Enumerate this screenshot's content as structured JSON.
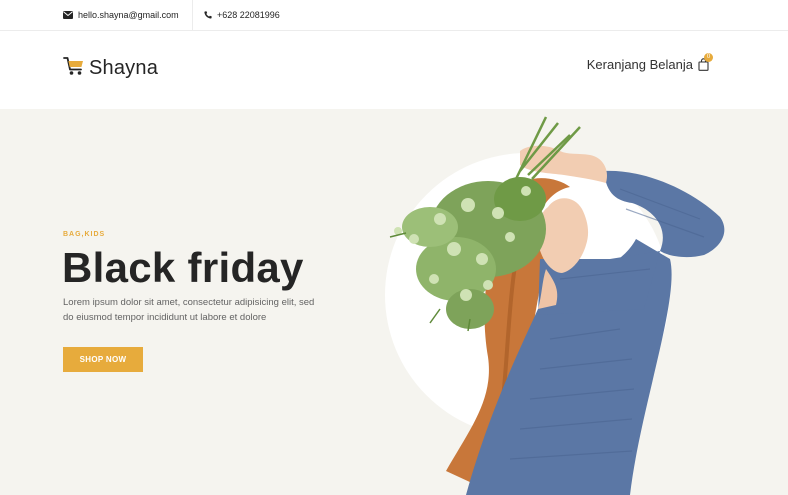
{
  "topbar": {
    "email": "hello.shayna@gmail.com",
    "phone": "+628 22081996"
  },
  "header": {
    "logo_text": "Shayna",
    "cart_label": "Keranjang Belanja",
    "cart_count": "0"
  },
  "hero": {
    "tag": "BAG,KIDS",
    "title": "Black friday",
    "description": "Lorem ipsum dolor sit amet, consectetur adipisicing elit, sed do eiusmod tempor incididunt ut labore et dolore",
    "button_label": "SHOP NOW"
  },
  "colors": {
    "accent": "#e7ab3c",
    "hero_background": "#f5f4ef",
    "text_dark": "#252525",
    "sweater": "#5b77a5"
  },
  "icons": [
    "envelope-icon",
    "phone-icon",
    "shopping-cart-icon",
    "shopping-bag-icon"
  ]
}
